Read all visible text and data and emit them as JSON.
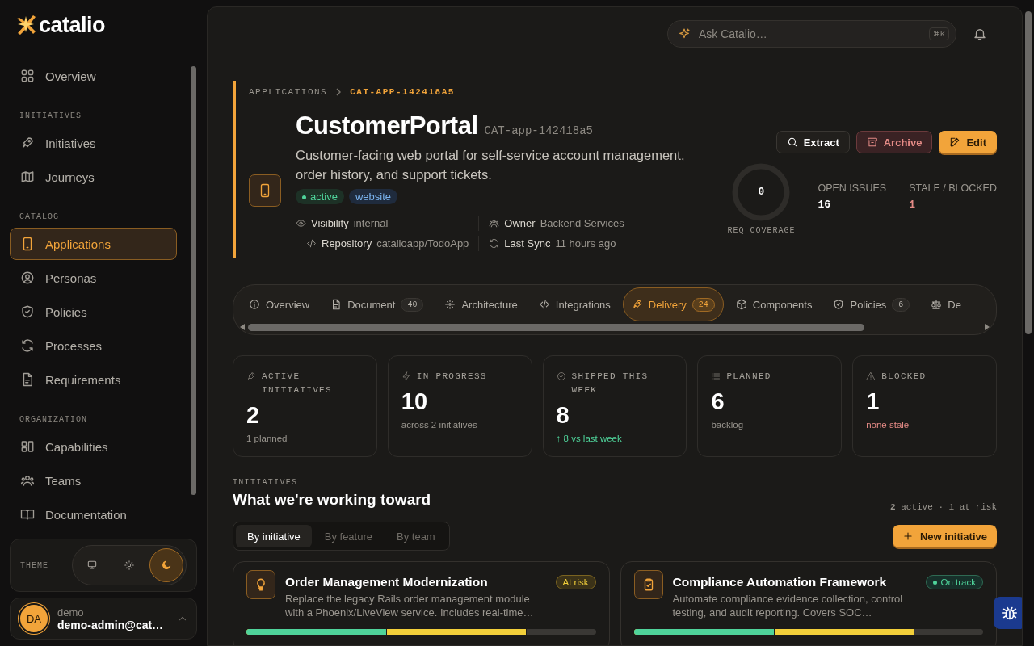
{
  "brand": {
    "name": "catalio"
  },
  "sidebar": {
    "sections": [
      {
        "items": [
          {
            "label": "Overview",
            "selected": false
          }
        ]
      },
      {
        "label": "INITIATIVES",
        "items": [
          {
            "label": "Initiatives",
            "selected": false
          },
          {
            "label": "Journeys",
            "selected": false
          }
        ]
      },
      {
        "label": "CATALOG",
        "items": [
          {
            "label": "Applications",
            "selected": true
          },
          {
            "label": "Personas",
            "selected": false
          },
          {
            "label": "Policies",
            "selected": false
          },
          {
            "label": "Processes",
            "selected": false
          },
          {
            "label": "Requirements",
            "selected": false
          }
        ]
      },
      {
        "label": "ORGANIZATION",
        "items": [
          {
            "label": "Capabilities",
            "selected": false
          },
          {
            "label": "Teams",
            "selected": false
          },
          {
            "label": "Documentation",
            "selected": false
          }
        ]
      }
    ],
    "theme": {
      "label": "THEME",
      "options": [
        {
          "selected": false
        },
        {
          "selected": false
        },
        {
          "selected": true
        }
      ]
    },
    "user": {
      "initials": "DA",
      "name": "demo",
      "email": "demo-admin@cat…"
    }
  },
  "topbar": {
    "search": {
      "placeholder": "Ask Catalio…",
      "shortcut": "⌘K"
    }
  },
  "breadcrumb": [
    "APPLICATIONS",
    "CAT-APP-142418A5"
  ],
  "app": {
    "name": "CustomerPortal",
    "code": "CAT-app-142418a5",
    "description": "Customer-facing web portal for self-service account management, order history, and support tickets.",
    "tags": [
      {
        "label": "active",
        "kind": "status"
      },
      {
        "label": "website",
        "kind": "type"
      }
    ],
    "meta": [
      {
        "key": "Visibility",
        "value": "internal"
      },
      {
        "key": "Owner",
        "value": "Backend Services"
      },
      {
        "key": "Repository",
        "value": "catalioapp/TodoApp"
      },
      {
        "key": "Last Sync",
        "value": "11 hours ago"
      }
    ],
    "actions": [
      {
        "label": "Extract",
        "kind": "default"
      },
      {
        "label": "Archive",
        "kind": "danger"
      },
      {
        "label": "Edit",
        "kind": "primary"
      }
    ],
    "coverage": {
      "value": "0",
      "label": "REQ COVERAGE",
      "level": 0
    },
    "stats": [
      {
        "label": "OPEN ISSUES",
        "value": "16",
        "kind": "normal"
      },
      {
        "label": "STALE / BLOCKED",
        "value": "1",
        "kind": "negative"
      }
    ]
  },
  "tabs": [
    {
      "label": "Overview",
      "selected": false
    },
    {
      "label": "Document",
      "count": "40",
      "selected": false
    },
    {
      "label": "Architecture",
      "selected": false
    },
    {
      "label": "Integrations",
      "selected": false
    },
    {
      "label": "Delivery",
      "count": "24",
      "selected": true
    },
    {
      "label": "Components",
      "selected": false
    },
    {
      "label": "Policies",
      "count": "6",
      "selected": false
    },
    {
      "label": "De",
      "selected": false
    }
  ],
  "metrics": [
    {
      "label": "ACTIVE INITIATIVES",
      "value": "2",
      "note": "1 planned",
      "kind": "muted"
    },
    {
      "label": "IN PROGRESS",
      "value": "10",
      "note": "across 2 initiatives",
      "kind": "muted"
    },
    {
      "label": "SHIPPED THIS WEEK",
      "value": "8",
      "note": "↑ 8 vs last week",
      "kind": "positive"
    },
    {
      "label": "PLANNED",
      "value": "6",
      "note": "backlog",
      "kind": "muted"
    },
    {
      "label": "BLOCKED",
      "value": "1",
      "note": "none stale",
      "kind": "negative"
    }
  ],
  "initiatives": {
    "eyebrow": "INITIATIVES",
    "title": "What we're working toward",
    "summary": "**2** active · 1 at risk",
    "views": [
      {
        "label": "By initiative",
        "selected": true
      },
      {
        "label": "By feature",
        "selected": false
      },
      {
        "label": "By team",
        "selected": false
      }
    ],
    "new_button": "New initiative",
    "cards": [
      {
        "title": "Order Management Modernization",
        "description": "Replace the legacy Rails order management module with a Phoenix/LiveView service. Includes real-time…",
        "status": "At risk",
        "kind": "at_risk",
        "progress": [
          {
            "kind": "done",
            "level": 0.4
          },
          {
            "kind": "in_progress",
            "level": 0.8
          }
        ]
      },
      {
        "title": "Compliance Automation Framework",
        "description": "Automate compliance evidence collection, control testing, and audit reporting. Covers SOC…",
        "status": "On track",
        "kind": "on_track",
        "progress": [
          {
            "kind": "done",
            "level": 0.4
          },
          {
            "kind": "in_progress",
            "level": 0.8
          }
        ]
      }
    ]
  }
}
